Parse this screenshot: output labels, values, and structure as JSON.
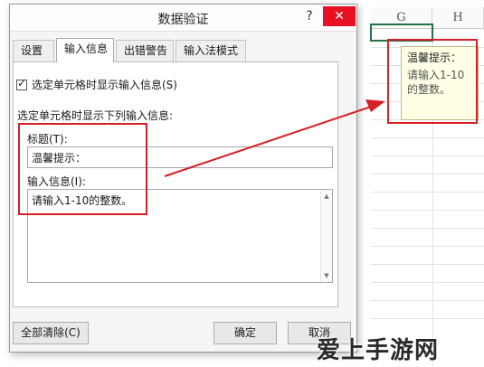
{
  "dialog": {
    "title": "数据验证",
    "help_glyph": "?",
    "close_glyph": "✕",
    "tabs": [
      {
        "label": "设置"
      },
      {
        "label": "输入信息"
      },
      {
        "label": "出错警告"
      },
      {
        "label": "输入法模式"
      }
    ],
    "active_tab": "输入信息",
    "show_input_checkbox_label": "选定单元格时显示输入信息(S)",
    "show_input_checked": true,
    "section_label": "选定单元格时显示下列输入信息:",
    "title_label": "标题(T):",
    "title_value": "温馨提示：",
    "message_label": "输入信息(I):",
    "message_value": "请输入1-10的整数。",
    "clear_button": "全部清除(C)",
    "ok_button": "确定",
    "cancel_button": "取消"
  },
  "sheet": {
    "columns": [
      "G",
      "H"
    ],
    "tooltip_title": "温馨提示：",
    "tooltip_body": "请输入1-10的整数。"
  },
  "watermark": {
    "text": "爱上手游网"
  },
  "colors": {
    "highlight": "#d61f26",
    "active_cell": "#217346",
    "tooltip_bg": "#ffffe6"
  }
}
